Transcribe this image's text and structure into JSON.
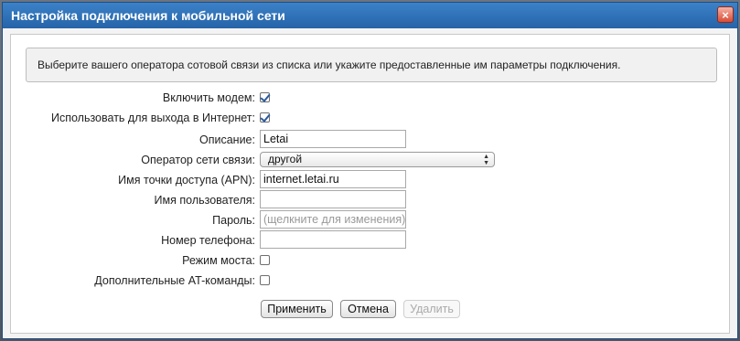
{
  "dialog": {
    "title": "Настройка подключения к мобильной сети",
    "close_glyph": "×",
    "info_text": "Выберите вашего оператора сотовой связи из списка или укажите предоставленные им параметры подключения."
  },
  "form": {
    "enable_modem": {
      "label": "Включить модем:",
      "checked": true
    },
    "use_for_internet": {
      "label": "Использовать для выхода в Интернет:",
      "checked": true
    },
    "description": {
      "label": "Описание:",
      "value": "Letai"
    },
    "operator": {
      "label": "Оператор сети связи:",
      "selected": "другой"
    },
    "apn": {
      "label": "Имя точки доступа (APN):",
      "value": "internet.letai.ru"
    },
    "username": {
      "label": "Имя пользователя:",
      "value": ""
    },
    "password": {
      "label": "Пароль:",
      "placeholder": "(щелкните для изменения)"
    },
    "phone": {
      "label": "Номер телефона:",
      "value": ""
    },
    "bridge_mode": {
      "label": "Режим моста:",
      "checked": false
    },
    "at_commands": {
      "label": "Дополнительные AT-команды:",
      "checked": false
    }
  },
  "buttons": {
    "apply": "Применить",
    "cancel": "Отмена",
    "delete": "Удалить"
  },
  "colors": {
    "titlebar": "#2f72b8",
    "close_button": "#d84a33",
    "checkmark": "#2a5aa0"
  }
}
